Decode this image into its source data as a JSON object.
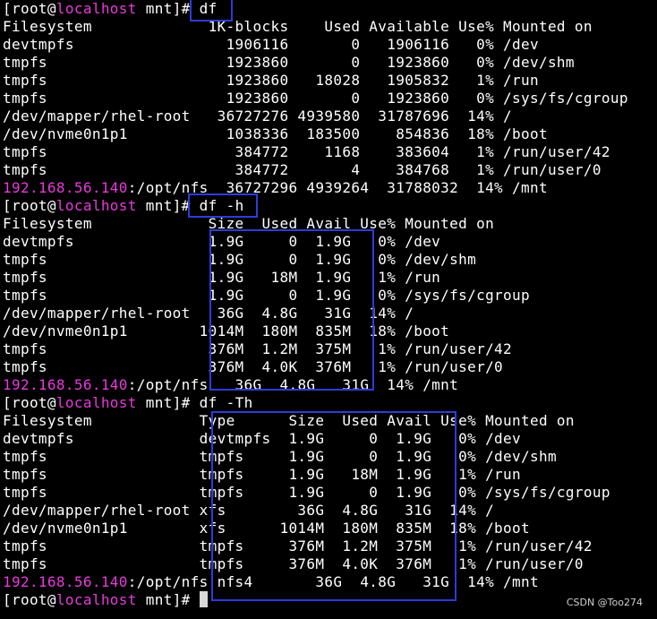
{
  "terminal": {
    "background": "#000000",
    "text_color": "#ffffff",
    "hostname_color": "#e83adc",
    "highlight_box_color": "#2d3cd9",
    "prompt": {
      "open": "[root@",
      "host": "localhost",
      "close": " mnt]# "
    },
    "commands": [
      "df",
      "df -h",
      "df -Th",
      ""
    ],
    "df_output": {
      "header": "Filesystem             1K-blocks    Used Available Use% Mounted on",
      "rows": [
        "devtmpfs                 1906116       0   1906116   0% /dev",
        "tmpfs                    1923860       0   1923860   0% /dev/shm",
        "tmpfs                    1923860   18028   1905832   1% /run",
        "tmpfs                    1923860       0   1923860   0% /sys/fs/cgroup",
        "/dev/mapper/rhel-root   36727276 4939580  31787696  14% /",
        "/dev/nvme0n1p1           1038336  183500    854836  18% /boot",
        "tmpfs                     384772    1168    383604   1% /run/user/42",
        "tmpfs                     384772       4    384768   1% /run/user/0"
      ],
      "nfs_host": "192.168.56.140",
      "nfs_rest": ":/opt/nfs  36727296 4939264  31788032  14% /mnt"
    },
    "df_h_output": {
      "header": "Filesystem             Size  Used Avail Use% Mounted on",
      "rows": [
        "devtmpfs               1.9G     0  1.9G   0% /dev",
        "tmpfs                  1.9G     0  1.9G   0% /dev/shm",
        "tmpfs                  1.9G   18M  1.9G   1% /run",
        "tmpfs                  1.9G     0  1.9G   0% /sys/fs/cgroup",
        "/dev/mapper/rhel-root   36G  4.8G   31G  14% /",
        "/dev/nvme0n1p1        1014M  180M  835M  18% /boot",
        "tmpfs                  376M  1.2M  375M   1% /run/user/42",
        "tmpfs                  376M  4.0K  376M   1% /run/user/0"
      ],
      "nfs_host": "192.168.56.140",
      "nfs_rest": ":/opt/nfs   36G  4.8G   31G  14% /mnt"
    },
    "df_th_output": {
      "header": "Filesystem            Type      Size  Used Avail Use% Mounted on",
      "rows": [
        "devtmpfs              devtmpfs  1.9G     0  1.9G   0% /dev",
        "tmpfs                 tmpfs     1.9G     0  1.9G   0% /dev/shm",
        "tmpfs                 tmpfs     1.9G   18M  1.9G   1% /run",
        "tmpfs                 tmpfs     1.9G     0  1.9G   0% /sys/fs/cgroup",
        "/dev/mapper/rhel-root xfs        36G  4.8G   31G  14% /",
        "/dev/nvme0n1p1        xfs      1014M  180M  835M  18% /boot",
        "tmpfs                 tmpfs     376M  1.2M  375M   1% /run/user/42",
        "tmpfs                 tmpfs     376M  4.0K  376M   1% /run/user/0"
      ],
      "nfs_host": "192.168.56.140",
      "nfs_rest": ":/opt/nfs nfs4       36G  4.8G   31G  14% /mnt"
    },
    "watermark": "CSDN @Too274"
  }
}
